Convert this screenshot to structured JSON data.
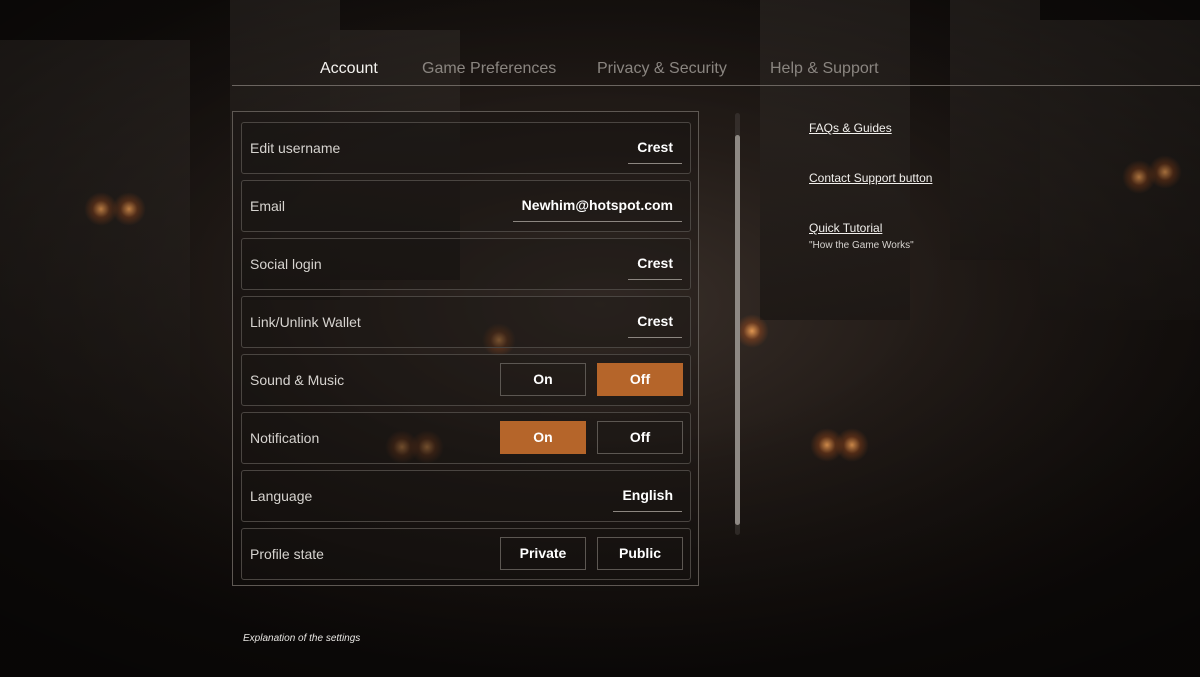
{
  "tabs": [
    {
      "label": "Account",
      "active": true
    },
    {
      "label": "Game Preferences",
      "active": false
    },
    {
      "label": "Privacy & Security",
      "active": false
    },
    {
      "label": "Help & Support",
      "active": false
    }
  ],
  "settings": {
    "edit_username": {
      "label": "Edit username",
      "value": "Crest"
    },
    "email": {
      "label": "Email",
      "value": "Newhim@hotspot.com"
    },
    "social_login": {
      "label": "Social login",
      "value": "Crest"
    },
    "wallet": {
      "label": "Link/Unlink Wallet",
      "value": "Crest"
    },
    "sound_music": {
      "label": "Sound & Music",
      "option_a": "On",
      "option_b": "Off",
      "selected": "Off"
    },
    "notification": {
      "label": "Notification",
      "option_a": "On",
      "option_b": "Off",
      "selected": "On"
    },
    "language": {
      "label": "Language",
      "value": "English"
    },
    "profile_state": {
      "label": "Profile state",
      "option_a": "Private",
      "option_b": "Public",
      "selected": null
    }
  },
  "help_links": {
    "faqs": "FAQs & Guides",
    "contact": "Contact Support button",
    "tutorial": "Quick Tutorial",
    "tutorial_sub": "\"How the Game Works\""
  },
  "footnote": "Explanation of the settings",
  "colors": {
    "accent": "#b5652a",
    "active_tab": "#f4f2ef",
    "inactive_tab": "#8a8580"
  }
}
